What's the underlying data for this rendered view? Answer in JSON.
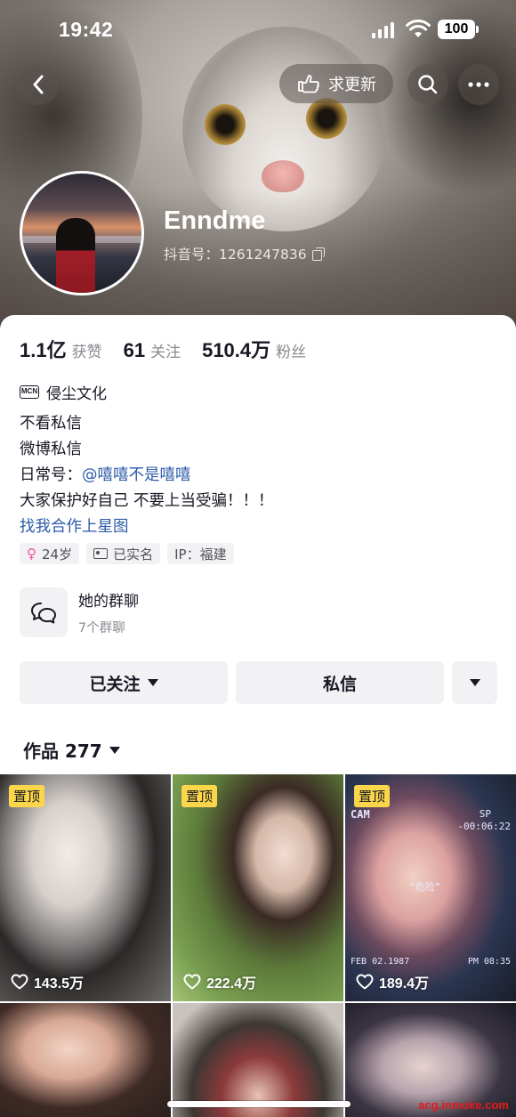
{
  "status_bar": {
    "time": "19:42",
    "battery": "100"
  },
  "header": {
    "update_label": "求更新",
    "icons": [
      "chevron-left-icon",
      "hand-point-icon",
      "search-icon",
      "more-icon"
    ]
  },
  "profile": {
    "name": "Enndme",
    "douyin_id": "抖音号：1261247836"
  },
  "stats": [
    {
      "num": "1.1亿",
      "label": "获赞"
    },
    {
      "num": "61",
      "label": "关注"
    },
    {
      "num": "510.4万",
      "label": "粉丝"
    }
  ],
  "mcn": {
    "badge": "MCN",
    "name": "侵尘文化"
  },
  "bio": {
    "line1": "不看私信",
    "line2": "微博私信",
    "line3_prefix": "日常号：",
    "line3_link": "@嘻嘻不是嘻嘻",
    "line4": "大家保护好自己 不要上当受骗！！！",
    "line5": "找我合作上星图"
  },
  "tags": {
    "age": "24岁",
    "verified": "已实名",
    "ip": "IP：福建"
  },
  "group": {
    "title": "她的群聊",
    "sub": "7个群聊"
  },
  "actions": {
    "follow": "已关注",
    "message": "私信"
  },
  "works": {
    "label": "作品 277"
  },
  "grid": [
    {
      "pinned": "置顶",
      "likes": "143.5万"
    },
    {
      "pinned": "置顶",
      "likes": "222.4万"
    },
    {
      "pinned": "置顶",
      "likes": "189.4万",
      "cam": "CAM",
      "sp": "SP",
      "timer": "-00:06:22",
      "quote": "“危险”",
      "date": "FEB 02.1987",
      "clock": "PM 08:35"
    }
  ],
  "watermark": "acg.inmoke.com"
}
